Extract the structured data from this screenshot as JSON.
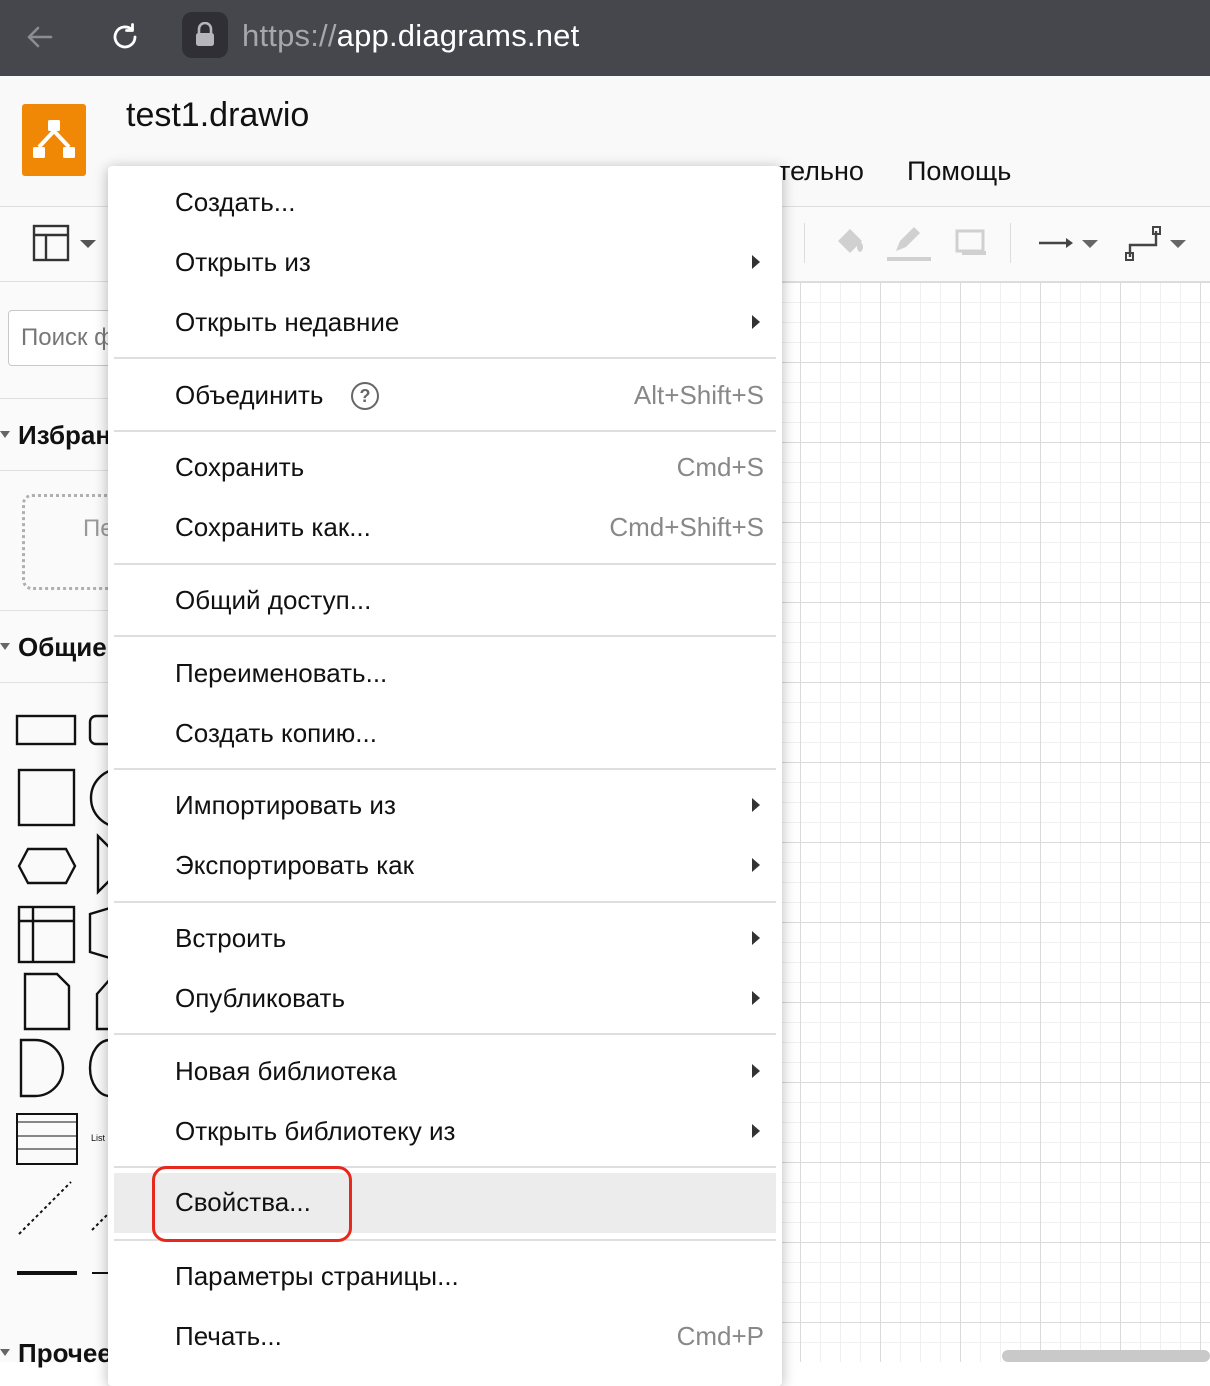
{
  "browser": {
    "url_prefix": "https://",
    "url_host": "app.diagrams.net",
    "back_icon": "arrow-left-icon",
    "reload_icon": "reload-icon",
    "lock_icon": "lock-icon"
  },
  "app": {
    "file_title": "test1.drawio",
    "menubar_visible": [
      "тельно",
      "Помощь"
    ],
    "brand_color": "#f08705"
  },
  "sidebar": {
    "search_placeholder": "Поиск ф",
    "sections": [
      "Избран",
      "Общие",
      "Прочее"
    ],
    "scratchpad_hint": "Пе",
    "list_shape_label": "List"
  },
  "file_menu": {
    "groups": [
      [
        {
          "label": "Создать...",
          "shortcut": "",
          "submenu": false
        },
        {
          "label": "Открыть из",
          "shortcut": "",
          "submenu": true
        },
        {
          "label": "Открыть недавние",
          "shortcut": "",
          "submenu": true
        }
      ],
      [
        {
          "label": "Объединить",
          "shortcut": "Alt+Shift+S",
          "submenu": false,
          "help": true
        }
      ],
      [
        {
          "label": "Сохранить",
          "shortcut": "Cmd+S",
          "submenu": false
        },
        {
          "label": "Сохранить как...",
          "shortcut": "Cmd+Shift+S",
          "submenu": false
        }
      ],
      [
        {
          "label": "Общий доступ...",
          "shortcut": "",
          "submenu": false
        }
      ],
      [
        {
          "label": "Переименовать...",
          "shortcut": "",
          "submenu": false
        },
        {
          "label": "Создать копию...",
          "shortcut": "",
          "submenu": false
        }
      ],
      [
        {
          "label": "Импортировать из",
          "shortcut": "",
          "submenu": true
        },
        {
          "label": "Экспортировать как",
          "shortcut": "",
          "submenu": true
        }
      ],
      [
        {
          "label": "Встроить",
          "shortcut": "",
          "submenu": true
        },
        {
          "label": "Опубликовать",
          "shortcut": "",
          "submenu": true
        }
      ],
      [
        {
          "label": "Новая библиотека",
          "shortcut": "",
          "submenu": true
        },
        {
          "label": "Открыть библиотеку из",
          "shortcut": "",
          "submenu": true
        }
      ],
      [
        {
          "label": "Свойства...",
          "shortcut": "",
          "submenu": false,
          "highlighted": true
        }
      ],
      [
        {
          "label": "Параметры страницы...",
          "shortcut": "",
          "submenu": false
        },
        {
          "label": "Печать...",
          "shortcut": "Cmd+P",
          "submenu": false
        }
      ]
    ],
    "highlight_color": "#e6291c"
  }
}
